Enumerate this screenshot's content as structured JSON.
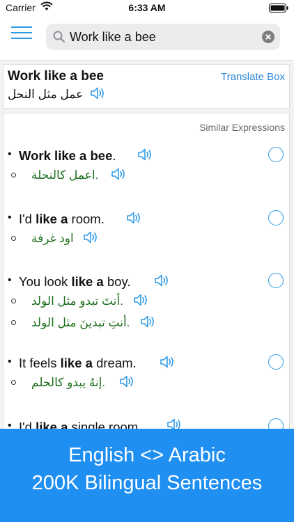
{
  "status_bar": {
    "carrier": "Carrier",
    "time": "6:33 AM"
  },
  "search": {
    "query": "Work like a bee",
    "icon": "search-icon",
    "clear_icon": "clear-icon"
  },
  "result": {
    "headword": "Work like a bee",
    "translate_label": "Translate Box",
    "translation": "عمل مثل النحل"
  },
  "similar": {
    "heading": "Similar Expressions",
    "entries": [
      {
        "pre": "",
        "bold": "Work like a bee",
        "post": ".",
        "translations": [
          ".اعمل كالنحلة"
        ]
      },
      {
        "pre": "I'd ",
        "bold": "like a",
        "post": " room.",
        "translations": [
          "اود غرفة"
        ]
      },
      {
        "pre": "You look ",
        "bold": "like a",
        "post": " boy.",
        "translations": [
          ".أنتَ تبدو مثل الولد",
          ".أنتِ تبدينَ مثل الولد"
        ]
      },
      {
        "pre": "It feels ",
        "bold": "like a",
        "post": " dream.",
        "translations": [
          ".إنهُ يبدو كالحلم"
        ]
      },
      {
        "pre": "I'd ",
        "bold": "like a",
        "post": " single room.",
        "translations": []
      }
    ]
  },
  "promo": {
    "line1": "English <> Arabic",
    "line2": "200K Bilingual Sentences"
  },
  "colors": {
    "accent": "#2f9be8",
    "arabic_text": "#1e6f1e",
    "banner": "#1f8ff2"
  }
}
